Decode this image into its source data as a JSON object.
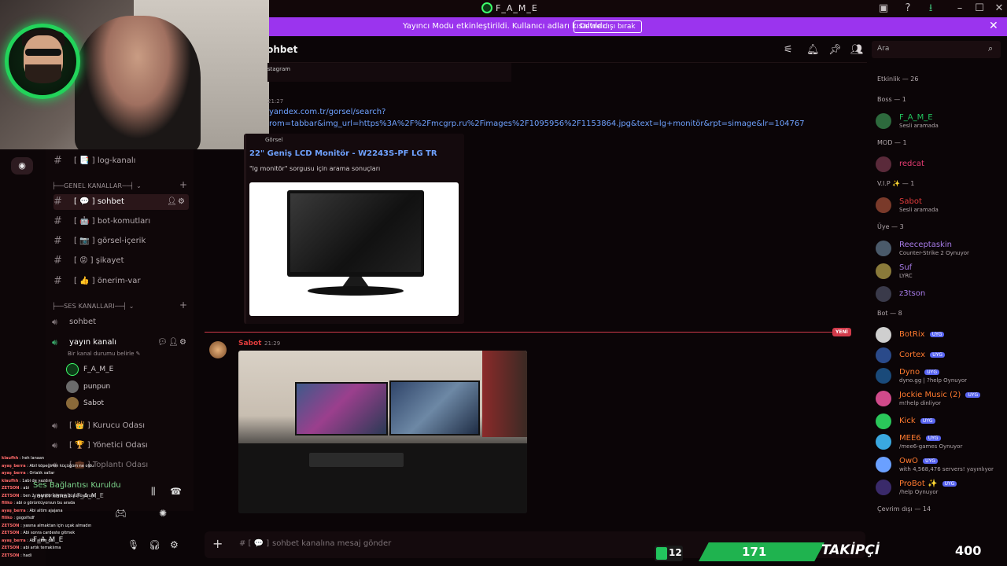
{
  "window": {
    "title": "F_A_M_E"
  },
  "banner": {
    "message": "Yayıncı Modu etkinleştirildi. Kullanıcı adları kısaltıldı.",
    "button": "Devre dışı bırak",
    "close": "✕"
  },
  "header": {
    "channel": "sohbet",
    "search_placeholder": "Ara"
  },
  "channels": {
    "log": "log-kanalı",
    "category_general": "GENEL KANALLAR",
    "text": [
      {
        "label": "sohbet"
      },
      {
        "label": "bot-komutları"
      },
      {
        "label": "görsel-içerik"
      },
      {
        "label": "şikayet"
      },
      {
        "label": "önerim-var"
      }
    ],
    "category_voice": "SES KANALLARI",
    "voice": {
      "sohbet": "sohbet",
      "yayin": "yayın kanalı",
      "yayin_status": "Bir kanal durumu belirle",
      "users": [
        "F_A_M_E",
        "punpun",
        "Sabot"
      ],
      "kurucu": "Kurucu Odası",
      "yonetici": "Yönetici Odası",
      "toplanti": "Toplantı Odası"
    }
  },
  "userpanel": {
    "connection": "Ses Bağlantısı Kuruldu",
    "connection_sub": "yayın kanalı / F_A_M_E",
    "username": "F_A_M_E"
  },
  "messages": {
    "top_fragment": "stagram",
    "time1": "21:27",
    "link_line1": "yandex.com.tr/gorsel/search?",
    "link_line2": "rom=tabbar&img_url=https%3A%2F%2Fmcgrp.ru%2Fimages%2F1095956%2F1153864.jpg&text=lg+monitör&rpt=simage&lr=104767",
    "embed_provider": "Görsel",
    "embed_title": "22\" Geniş LCD Monitör - W2243S-PF LG TR",
    "embed_desc": "\"lg monitör\" sorgusu için arama sonuçları",
    "new_badge": "YENİ",
    "author2": "Sabot",
    "time2": "21:29",
    "composer_placeholder": "sohbet kanalına mesaj gönder"
  },
  "members": {
    "activity": "Etkinlik — 26",
    "boss_cat": "Boss — 1",
    "boss": [
      {
        "name": "F_A_M_E",
        "sub": "Sesli aramada",
        "color": "#22c55e"
      }
    ],
    "mod_cat": "MOD — 1",
    "mod": [
      {
        "name": "redcat",
        "color": "#e83d74"
      }
    ],
    "vip_cat": "V.I.P ✨ — 1",
    "vip": [
      {
        "name": "Sabot",
        "sub": "Sesli aramada",
        "color": "#e23c3c"
      }
    ],
    "uye_cat": "Üye — 3",
    "uye": [
      {
        "name": "Reeceptaskin",
        "sub": "Counter-Strike 2 Oynuyor",
        "color": "#a77be8"
      },
      {
        "name": "Suf",
        "sub": "LYRC",
        "color": "#a77be8"
      },
      {
        "name": "z3tson",
        "color": "#a77be8"
      }
    ],
    "bot_cat": "Bot — 8",
    "bots": [
      {
        "name": "BotRix",
        "tag": "UYG",
        "color": "#ff7a2f"
      },
      {
        "name": "Cortex",
        "tag": "UYG",
        "color": "#ff7a2f"
      },
      {
        "name": "Dyno",
        "tag": "UYG",
        "sub": "dyno.gg | ?help Oynuyor",
        "color": "#ff7a2f"
      },
      {
        "name": "Jockie Music (2)",
        "tag": "UYG",
        "sub": "m!help dinliyor",
        "color": "#ff7a2f"
      },
      {
        "name": "Kick",
        "tag": "UYG",
        "color": "#ff7a2f"
      },
      {
        "name": "MEE6",
        "tag": "UYG",
        "sub": "/mee6-games Oynuyor",
        "color": "#ff7a2f"
      },
      {
        "name": "OwO",
        "tag": "UYG",
        "sub": "with 4,568,476 servers! yayınlıyor",
        "color": "#ff7a2f"
      },
      {
        "name": "ProBot ✨",
        "tag": "UYG",
        "sub": "/help Oynuyor",
        "color": "#ff7a2f"
      }
    ],
    "offline_cat": "Çevrim dışı — 14"
  },
  "stream": {
    "level": "12",
    "followers_now": "171",
    "label": "TAKİPÇİ",
    "followers_goal": "400"
  },
  "chat_overlay": [
    {
      "user": "klaufhh",
      "text": "heh lanaan"
    },
    {
      "user": "ayaş_berra",
      "text": "Abil köpeğimin küçüğüm ne oldu"
    },
    {
      "user": "ayaş_berra",
      "text": "Ortalık sallar"
    },
    {
      "user": "klaufhh",
      "text": "1abi de yazdım"
    },
    {
      "user": "ZETSON",
      "text": "abi"
    },
    {
      "user": "ZETSON",
      "text": "ben 2. monitör almayı düşünüyorum"
    },
    {
      "user": "filiko",
      "text": "abi o görüntüyorsun bu arada"
    },
    {
      "user": "ayaş_berra",
      "text": "Abi altim ajajana"
    },
    {
      "user": "filiko",
      "text": "gogoifsdf"
    },
    {
      "user": "ZETSON",
      "text": "yasına almaktan için uçak almadın"
    },
    {
      "user": "ZETSON",
      "text": "Abi sonra cardeste gitmek"
    },
    {
      "user": "ayaş_berra",
      "text": "Abi altım da"
    },
    {
      "user": "ZETSON",
      "text": "abi artık terraklıma"
    },
    {
      "user": "ZETSON",
      "text": "hadi"
    }
  ]
}
